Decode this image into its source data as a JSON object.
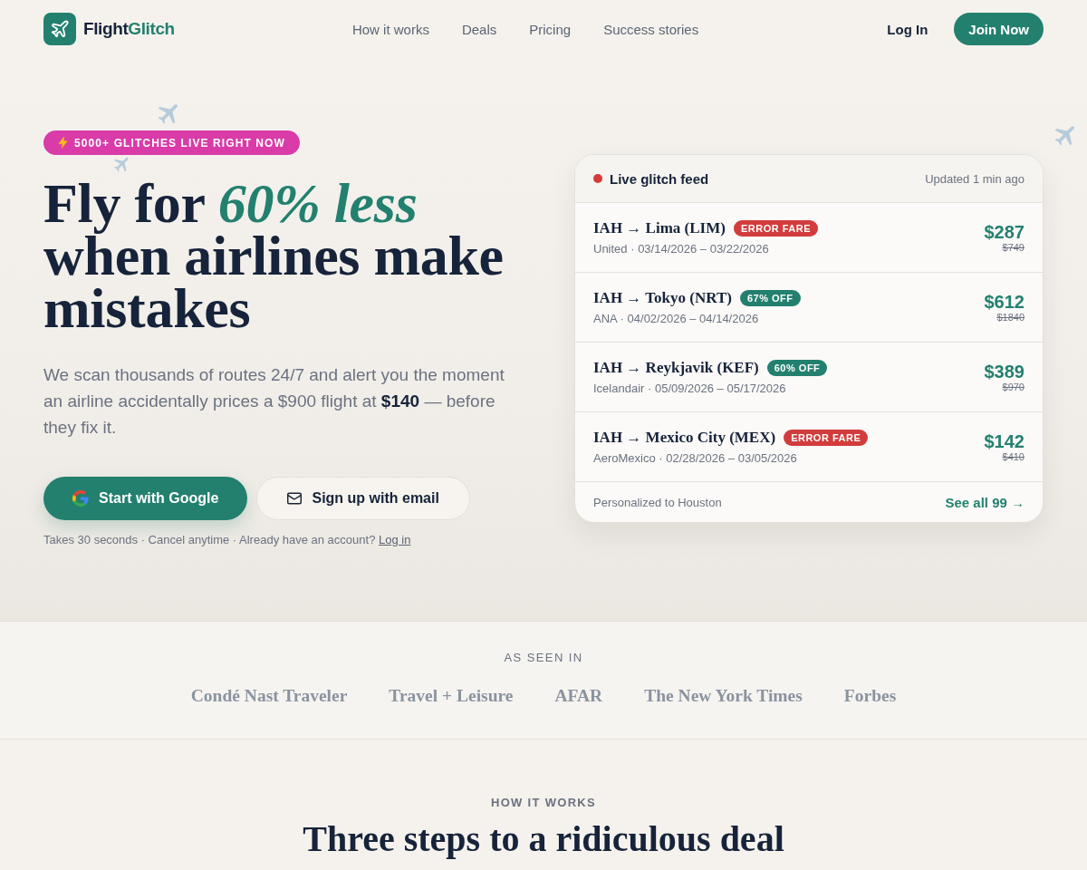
{
  "nav": {
    "logo": {
      "text": "Flight",
      "accent": "Glitch"
    },
    "links": [
      {
        "label": "How it works"
      },
      {
        "label": "Deals"
      },
      {
        "label": "Pricing"
      },
      {
        "label": "Success stories"
      }
    ],
    "login": "Log In",
    "cta": "Join Now"
  },
  "hero": {
    "badge": "5000+ GLITCHES LIVE RIGHT NOW",
    "headline": "Fly for *60% less* when airlines make mistakes",
    "description": "We scan thousands of routes 24/7 and alert you the moment an airline accidentally prices a $900 flight at **$140** — before they fix it.",
    "buttons": [
      {
        "kind": "google",
        "label": "Start with Google"
      },
      {
        "kind": "email",
        "label": "Sign up with email"
      }
    ],
    "note": "Takes 30 seconds · Cancel anytime · Already have an account?",
    "note_link": "Log in"
  },
  "feed": {
    "title": "Live glitch feed",
    "updated": "Updated 1 min ago",
    "deals": [
      {
        "route": "IAH → Lima (LIM)",
        "tag": {
          "kind": "error",
          "label": "ERROR FARE"
        },
        "details": "United · 03/14/2026 – 03/22/2026",
        "price": "$287",
        "old_price": "$749"
      },
      {
        "route": "IAH → Tokyo (NRT)",
        "tag": {
          "kind": "discount",
          "label": "67% OFF"
        },
        "details": "ANA · 04/02/2026 – 04/14/2026",
        "price": "$612",
        "old_price": "$1840"
      },
      {
        "route": "IAH → Reykjavik (KEF)",
        "tag": {
          "kind": "discount",
          "label": "60% OFF"
        },
        "details": "Icelandair · 05/09/2026 – 05/17/2026",
        "price": "$389",
        "old_price": "$970"
      },
      {
        "route": "IAH → Mexico City (MEX)",
        "tag": {
          "kind": "error",
          "label": "ERROR FARE"
        },
        "details": "AeroMexico · 02/28/2026 – 03/05/2026",
        "price": "$142",
        "old_price": "$410"
      }
    ],
    "footer": "Personalized to Houston",
    "link": "See all 99 →"
  },
  "press": {
    "heading": "AS SEEN IN",
    "outlets": [
      "Condé Nast Traveler",
      "Travel + Leisure",
      "AFAR",
      "The New York Times",
      "Forbes"
    ]
  },
  "how_it_works": {
    "eyebrow": "HOW IT WORKS",
    "title": "Three steps to a ridiculous deal"
  }
}
